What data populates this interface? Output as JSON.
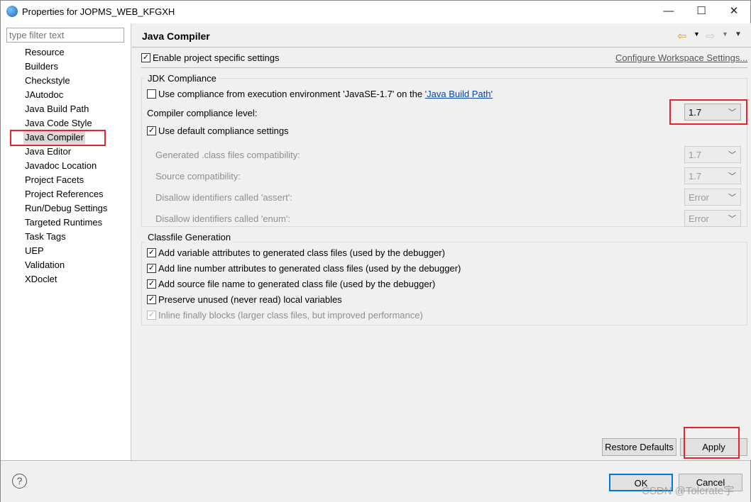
{
  "window": {
    "title": "Properties for JOPMS_WEB_KFGXH"
  },
  "sidebar": {
    "filter_placeholder": "type filter text",
    "items": [
      "Resource",
      "Builders",
      "Checkstyle",
      "JAutodoc",
      "Java Build Path",
      "Java Code Style",
      "Java Compiler",
      "Java Editor",
      "Javadoc Location",
      "Project Facets",
      "Project References",
      "Run/Debug Settings",
      "Targeted Runtimes",
      "Task Tags",
      "UEP",
      "Validation",
      "XDoclet"
    ],
    "selected": "Java Compiler"
  },
  "page": {
    "title": "Java Compiler",
    "enable_label": "Enable project specific settings",
    "enable_checked": true,
    "configure_link": "Configure Workspace Settings..."
  },
  "jdk": {
    "group": "JDK Compliance",
    "use_env_prefix": "Use compliance from execution environment 'JavaSE-1.7' on the ",
    "use_env_link": "'Java Build Path'",
    "use_env_checked": false,
    "level_label": "Compiler compliance level:",
    "level_value": "1.7",
    "default_label": "Use default compliance settings",
    "default_checked": true,
    "rows": [
      {
        "label": "Generated .class files compatibility:",
        "value": "1.7"
      },
      {
        "label": "Source compatibility:",
        "value": "1.7"
      },
      {
        "label": "Disallow identifiers called 'assert':",
        "value": "Error"
      },
      {
        "label": "Disallow identifiers called 'enum':",
        "value": "Error"
      }
    ]
  },
  "classfile": {
    "group": "Classfile Generation",
    "items": [
      {
        "label": "Add variable attributes to generated class files (used by the debugger)",
        "checked": true,
        "enabled": true
      },
      {
        "label": "Add line number attributes to generated class files (used by the debugger)",
        "checked": true,
        "enabled": true
      },
      {
        "label": "Add source file name to generated class file (used by the debugger)",
        "checked": true,
        "enabled": true
      },
      {
        "label": "Preserve unused (never read) local variables",
        "checked": true,
        "enabled": true
      },
      {
        "label": "Inline finally blocks (larger class files, but improved performance)",
        "checked": true,
        "enabled": false
      }
    ]
  },
  "buttons": {
    "restore": "Restore Defaults",
    "apply": "Apply",
    "ok": "OK",
    "cancel": "Cancel",
    "help": "?"
  },
  "watermark": "CSDN @Tolerate宇",
  "colors": {
    "highlight": "#e8232f",
    "ok_border": "#0078d7"
  }
}
